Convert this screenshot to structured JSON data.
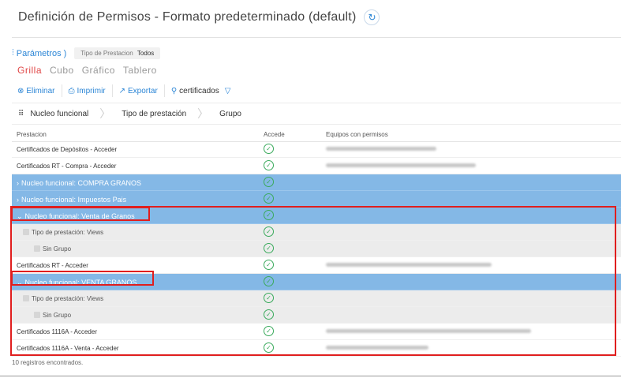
{
  "header": {
    "title": "Definición de Permisos - Formato predeterminado (default)",
    "refresh_icon": "refresh-icon"
  },
  "filters": {
    "params_label": "Parámetros",
    "chip_label": "Tipo de Prestacion",
    "chip_value": "Todos"
  },
  "views": [
    "Grilla",
    "Cubo",
    "Gráfico",
    "Tablero"
  ],
  "toolbar": {
    "delete": "Eliminar",
    "print": "Imprimir",
    "export": "Exportar",
    "search": "certificados"
  },
  "groupbar": [
    "Nucleo funcional",
    "Tipo de prestación",
    "Grupo"
  ],
  "columns": {
    "prestacion": "Prestacion",
    "accede": "Accede",
    "equipos": "Equipos con permisos"
  },
  "rows": [
    {
      "type": "data",
      "label": "Certificados de Depósitos - Acceder",
      "blur": 140
    },
    {
      "type": "data",
      "label": "Certificados RT - Compra - Acceder",
      "blur": 190
    },
    {
      "type": "group",
      "chevron": "›",
      "label": "Nucleo funcional: COMPRA GRANOS"
    },
    {
      "type": "group",
      "chevron": "›",
      "label": "Nucleo funcional: Impuestos Pais"
    },
    {
      "type": "group",
      "chevron": "⌄",
      "label": "Nucleo funcional: Venta de Granos"
    },
    {
      "type": "sub",
      "indent": 1,
      "label": "Tipo de prestación: Views"
    },
    {
      "type": "sub",
      "indent": 2,
      "label": "Sin Grupo"
    },
    {
      "type": "data",
      "label": "Certificados RT - Acceder",
      "blur": 210
    },
    {
      "type": "group",
      "chevron": "⌄",
      "label": "Nucleo funcional: VENTA GRANOS"
    },
    {
      "type": "sub",
      "indent": 1,
      "label": "Tipo de prestación: Views"
    },
    {
      "type": "sub",
      "indent": 2,
      "label": "Sin Grupo"
    },
    {
      "type": "data",
      "label": "Certificados 1116A - Acceder",
      "blur": 260
    },
    {
      "type": "data",
      "label": "Certificados 1116A - Venta - Acceder",
      "blur": 130
    }
  ],
  "footer": "10 registros encontrados."
}
